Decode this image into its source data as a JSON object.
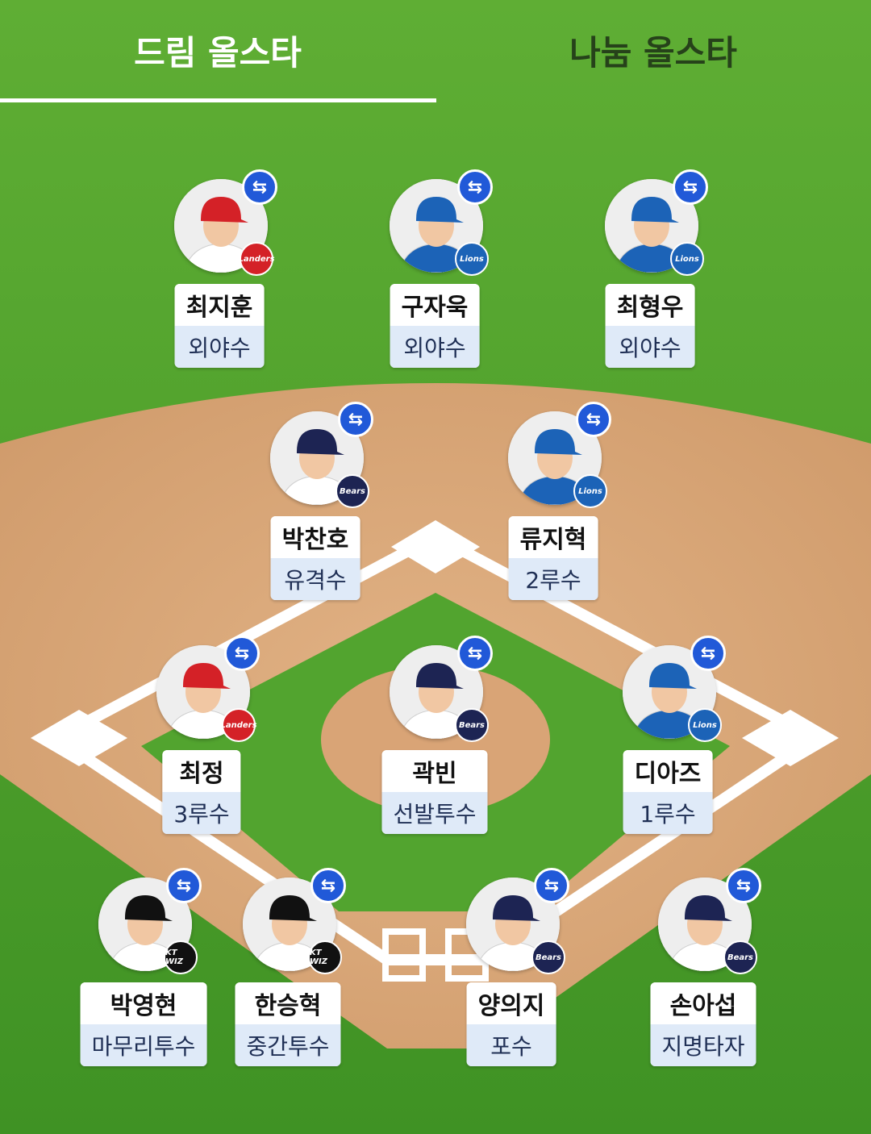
{
  "tabs": [
    {
      "label": "드림 올스타",
      "active": true
    },
    {
      "label": "나눔 올스타",
      "active": false
    }
  ],
  "colors": {
    "grass_light": "#6fb93b",
    "grass_dark": "#4a9a2a",
    "dirt": "#dba778",
    "swap_button": "#2159d8",
    "position_bg": "#dfeaf8"
  },
  "swap_icon": "⇆",
  "team_logos": {
    "landers": {
      "text": "Landers",
      "color": "#d42127"
    },
    "lions": {
      "text": "Lions",
      "color": "#1c63b7"
    },
    "bears": {
      "text": "Bears",
      "color": "#1d2453"
    },
    "ktwiz": {
      "text": "KT WIZ",
      "color": "#111111"
    }
  },
  "players": [
    {
      "name": "최지훈",
      "position": "외야수",
      "team": "landers",
      "cap_color": "#d42127",
      "uniform_color": "#ffffff"
    },
    {
      "name": "구자욱",
      "position": "외야수",
      "team": "lions",
      "cap_color": "#1c63b7",
      "uniform_color": "#1c63b7"
    },
    {
      "name": "최형우",
      "position": "외야수",
      "team": "lions",
      "cap_color": "#1c63b7",
      "uniform_color": "#1c63b7"
    },
    {
      "name": "박찬호",
      "position": "유격수",
      "team": "bears",
      "cap_color": "#1d2453",
      "uniform_color": "#ffffff"
    },
    {
      "name": "류지혁",
      "position": "2루수",
      "team": "lions",
      "cap_color": "#1c63b7",
      "uniform_color": "#1c63b7"
    },
    {
      "name": "최정",
      "position": "3루수",
      "team": "landers",
      "cap_color": "#d42127",
      "uniform_color": "#ffffff"
    },
    {
      "name": "곽빈",
      "position": "선발투수",
      "team": "bears",
      "cap_color": "#1d2453",
      "uniform_color": "#ffffff"
    },
    {
      "name": "디아즈",
      "position": "1루수",
      "team": "lions",
      "cap_color": "#1c63b7",
      "uniform_color": "#1c63b7"
    },
    {
      "name": "박영현",
      "position": "마무리투수",
      "team": "ktwiz",
      "cap_color": "#111111",
      "uniform_color": "#ffffff"
    },
    {
      "name": "한승혁",
      "position": "중간투수",
      "team": "ktwiz",
      "cap_color": "#111111",
      "uniform_color": "#ffffff"
    },
    {
      "name": "양의지",
      "position": "포수",
      "team": "bears",
      "cap_color": "#1d2453",
      "uniform_color": "#ffffff"
    },
    {
      "name": "손아섭",
      "position": "지명타자",
      "team": "bears",
      "cap_color": "#1d2453",
      "uniform_color": "#ffffff"
    }
  ]
}
